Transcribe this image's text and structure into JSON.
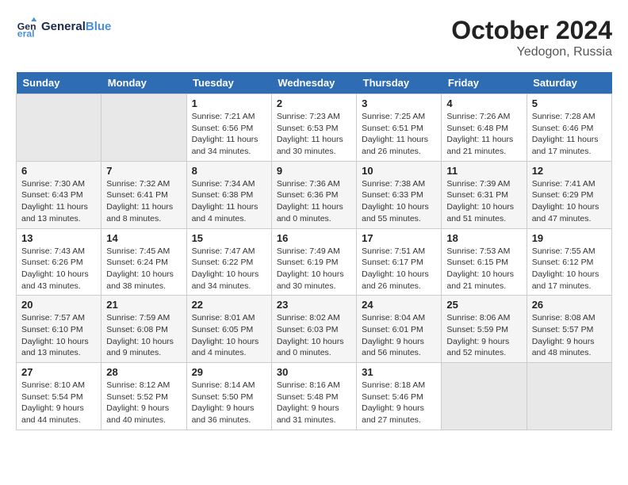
{
  "header": {
    "logo_general": "General",
    "logo_blue": "Blue",
    "month_year": "October 2024",
    "location": "Yedogon, Russia"
  },
  "weekdays": [
    "Sunday",
    "Monday",
    "Tuesday",
    "Wednesday",
    "Thursday",
    "Friday",
    "Saturday"
  ],
  "weeks": [
    [
      null,
      null,
      {
        "day": 1,
        "sunrise": "7:21 AM",
        "sunset": "6:56 PM",
        "daylight": "11 hours and 34 minutes."
      },
      {
        "day": 2,
        "sunrise": "7:23 AM",
        "sunset": "6:53 PM",
        "daylight": "11 hours and 30 minutes."
      },
      {
        "day": 3,
        "sunrise": "7:25 AM",
        "sunset": "6:51 PM",
        "daylight": "11 hours and 26 minutes."
      },
      {
        "day": 4,
        "sunrise": "7:26 AM",
        "sunset": "6:48 PM",
        "daylight": "11 hours and 21 minutes."
      },
      {
        "day": 5,
        "sunrise": "7:28 AM",
        "sunset": "6:46 PM",
        "daylight": "11 hours and 17 minutes."
      }
    ],
    [
      {
        "day": 6,
        "sunrise": "7:30 AM",
        "sunset": "6:43 PM",
        "daylight": "11 hours and 13 minutes."
      },
      {
        "day": 7,
        "sunrise": "7:32 AM",
        "sunset": "6:41 PM",
        "daylight": "11 hours and 8 minutes."
      },
      {
        "day": 8,
        "sunrise": "7:34 AM",
        "sunset": "6:38 PM",
        "daylight": "11 hours and 4 minutes."
      },
      {
        "day": 9,
        "sunrise": "7:36 AM",
        "sunset": "6:36 PM",
        "daylight": "11 hours and 0 minutes."
      },
      {
        "day": 10,
        "sunrise": "7:38 AM",
        "sunset": "6:33 PM",
        "daylight": "10 hours and 55 minutes."
      },
      {
        "day": 11,
        "sunrise": "7:39 AM",
        "sunset": "6:31 PM",
        "daylight": "10 hours and 51 minutes."
      },
      {
        "day": 12,
        "sunrise": "7:41 AM",
        "sunset": "6:29 PM",
        "daylight": "10 hours and 47 minutes."
      }
    ],
    [
      {
        "day": 13,
        "sunrise": "7:43 AM",
        "sunset": "6:26 PM",
        "daylight": "10 hours and 43 minutes."
      },
      {
        "day": 14,
        "sunrise": "7:45 AM",
        "sunset": "6:24 PM",
        "daylight": "10 hours and 38 minutes."
      },
      {
        "day": 15,
        "sunrise": "7:47 AM",
        "sunset": "6:22 PM",
        "daylight": "10 hours and 34 minutes."
      },
      {
        "day": 16,
        "sunrise": "7:49 AM",
        "sunset": "6:19 PM",
        "daylight": "10 hours and 30 minutes."
      },
      {
        "day": 17,
        "sunrise": "7:51 AM",
        "sunset": "6:17 PM",
        "daylight": "10 hours and 26 minutes."
      },
      {
        "day": 18,
        "sunrise": "7:53 AM",
        "sunset": "6:15 PM",
        "daylight": "10 hours and 21 minutes."
      },
      {
        "day": 19,
        "sunrise": "7:55 AM",
        "sunset": "6:12 PM",
        "daylight": "10 hours and 17 minutes."
      }
    ],
    [
      {
        "day": 20,
        "sunrise": "7:57 AM",
        "sunset": "6:10 PM",
        "daylight": "10 hours and 13 minutes."
      },
      {
        "day": 21,
        "sunrise": "7:59 AM",
        "sunset": "6:08 PM",
        "daylight": "10 hours and 9 minutes."
      },
      {
        "day": 22,
        "sunrise": "8:01 AM",
        "sunset": "6:05 PM",
        "daylight": "10 hours and 4 minutes."
      },
      {
        "day": 23,
        "sunrise": "8:02 AM",
        "sunset": "6:03 PM",
        "daylight": "10 hours and 0 minutes."
      },
      {
        "day": 24,
        "sunrise": "8:04 AM",
        "sunset": "6:01 PM",
        "daylight": "9 hours and 56 minutes."
      },
      {
        "day": 25,
        "sunrise": "8:06 AM",
        "sunset": "5:59 PM",
        "daylight": "9 hours and 52 minutes."
      },
      {
        "day": 26,
        "sunrise": "8:08 AM",
        "sunset": "5:57 PM",
        "daylight": "9 hours and 48 minutes."
      }
    ],
    [
      {
        "day": 27,
        "sunrise": "8:10 AM",
        "sunset": "5:54 PM",
        "daylight": "9 hours and 44 minutes."
      },
      {
        "day": 28,
        "sunrise": "8:12 AM",
        "sunset": "5:52 PM",
        "daylight": "9 hours and 40 minutes."
      },
      {
        "day": 29,
        "sunrise": "8:14 AM",
        "sunset": "5:50 PM",
        "daylight": "9 hours and 36 minutes."
      },
      {
        "day": 30,
        "sunrise": "8:16 AM",
        "sunset": "5:48 PM",
        "daylight": "9 hours and 31 minutes."
      },
      {
        "day": 31,
        "sunrise": "8:18 AM",
        "sunset": "5:46 PM",
        "daylight": "9 hours and 27 minutes."
      },
      null,
      null
    ]
  ]
}
